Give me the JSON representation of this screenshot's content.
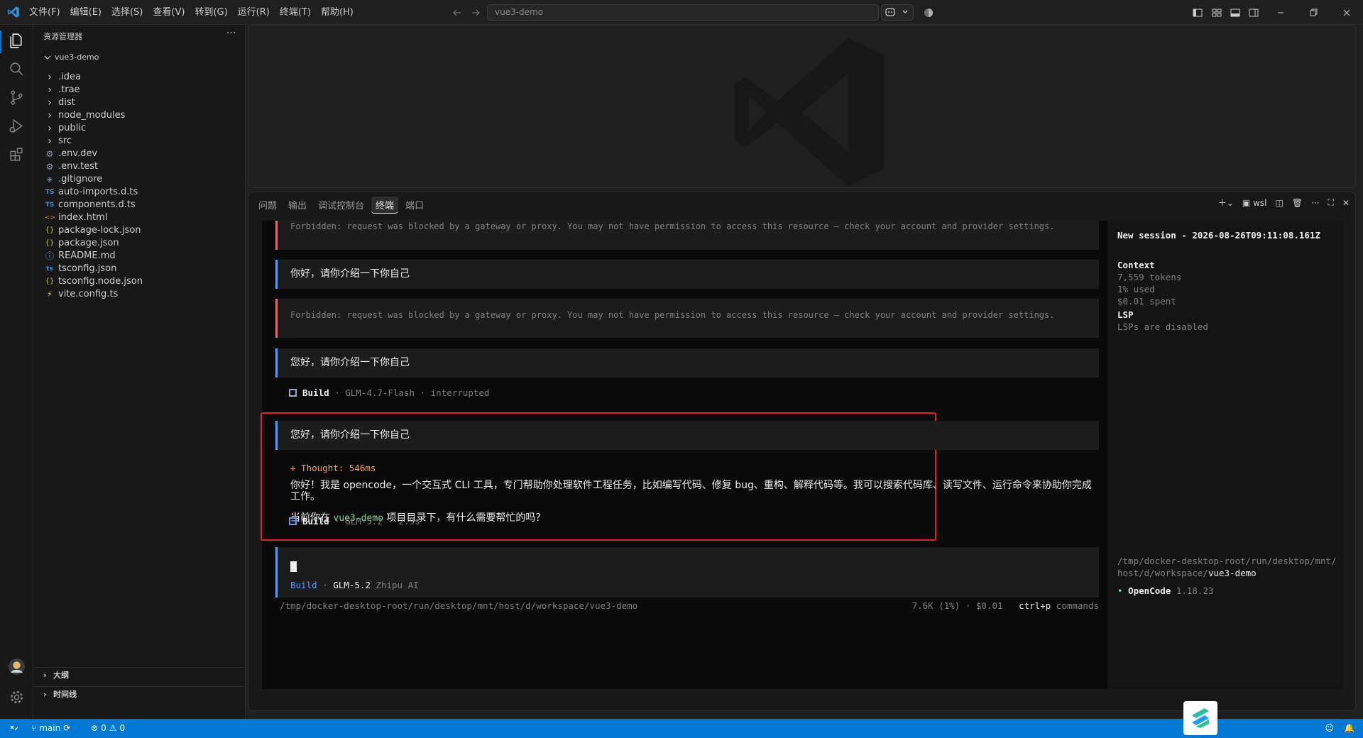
{
  "titlebar": {
    "menu": [
      "文件(F)",
      "编辑(E)",
      "选择(S)",
      "查看(V)",
      "转到(G)",
      "运行(R)",
      "终端(T)",
      "帮助(H)"
    ],
    "search_text": "vue3-demo"
  },
  "sidebar": {
    "title": "资源管理器",
    "root": "vue3-demo",
    "items": [
      {
        "name": ".idea",
        "type": "folder"
      },
      {
        "name": ".trae",
        "type": "folder"
      },
      {
        "name": "dist",
        "type": "folder"
      },
      {
        "name": "node_modules",
        "type": "folder"
      },
      {
        "name": "public",
        "type": "folder"
      },
      {
        "name": "src",
        "type": "folder"
      },
      {
        "name": ".env.dev",
        "type": "gear"
      },
      {
        "name": ".env.test",
        "type": "gear"
      },
      {
        "name": ".gitignore",
        "type": "diamond"
      },
      {
        "name": "auto-imports.d.ts",
        "type": "ts"
      },
      {
        "name": "components.d.ts",
        "type": "ts"
      },
      {
        "name": "index.html",
        "type": "html"
      },
      {
        "name": "package-lock.json",
        "type": "json"
      },
      {
        "name": "package.json",
        "type": "json"
      },
      {
        "name": "README.md",
        "type": "info"
      },
      {
        "name": "tsconfig.json",
        "type": "tsconfig"
      },
      {
        "name": "tsconfig.node.json",
        "type": "json"
      },
      {
        "name": "vite.config.ts",
        "type": "bolt"
      }
    ],
    "outline": "大纲",
    "timeline": "时间线"
  },
  "panel": {
    "tabs": [
      "问题",
      "输出",
      "调试控制台",
      "终端",
      "端口"
    ],
    "active_tab": "终端",
    "terminal_name": "wsl"
  },
  "terminal": {
    "error_text": "Forbidden: request was blocked by a gateway or proxy. You may not have permission to access this resource — check your account and provider settings.",
    "user_msg_1": "你好，请你介绍一下你自己",
    "user_msg_2": "您好，请你介绍一下你自己",
    "user_msg_3": "您好，请你介绍一下你自己",
    "build1": {
      "label": "Build",
      "model": "· GLM-4.7-Flash",
      "status": "· interrupted"
    },
    "thought": "+ Thought: 546ms",
    "reply_p1": "你好！我是 opencode，一个交互式 CLI 工具，专门帮助你处理软件工程任务，比如编写代码、修复 bug、重构、解释代码等。我可以搜索代码库、读写文件、运行命令来协助你完成工作。",
    "reply_p2_before": "当前你在 ",
    "reply_p2_highlight": "vue3-demo",
    "reply_p2_after": " 项目目录下，有什么需要帮忙的吗？",
    "build2": {
      "label": "Build",
      "model": "· GLM-5.2",
      "time": "· 2.9s"
    },
    "input_meta": {
      "agent": "Build",
      "sep": " · ",
      "model": "GLM-5.2",
      "provider": " Zhipu AI"
    },
    "status_path": "/tmp/docker-desktop-root/run/desktop/mnt/host/d/workspace/vue3-demo",
    "status_usage": "7.6K (1%) · $0.01",
    "status_shortcut": "ctrl+p",
    "status_commands": " commands"
  },
  "session_sidebar": {
    "title": "New session - 2026-08-26T09:11:08.161Z",
    "context_label": "Context",
    "tokens": "7,559 tokens",
    "used": "1% used",
    "spent": "$0.01 spent",
    "lsp_label": "LSP",
    "lsp_status": "LSPs are disabled",
    "path_prefix": "/tmp/docker-desktop-root/run/desktop/mnt/host/d/workspace/",
    "path_dir": "vue3-demo",
    "app_dot": "•",
    "app_name": "OpenCode",
    "app_version": "1.18.23"
  },
  "statusbar": {
    "branch": "main",
    "errors": "0",
    "warnings": "0"
  },
  "colors": {
    "accent": "#0078d4",
    "error_border": "#e06c75",
    "user_border": "#5c9cf5",
    "highlight_box": "#e5202b",
    "thought": "#f5a742",
    "path_highlight": "#7fd88f"
  }
}
